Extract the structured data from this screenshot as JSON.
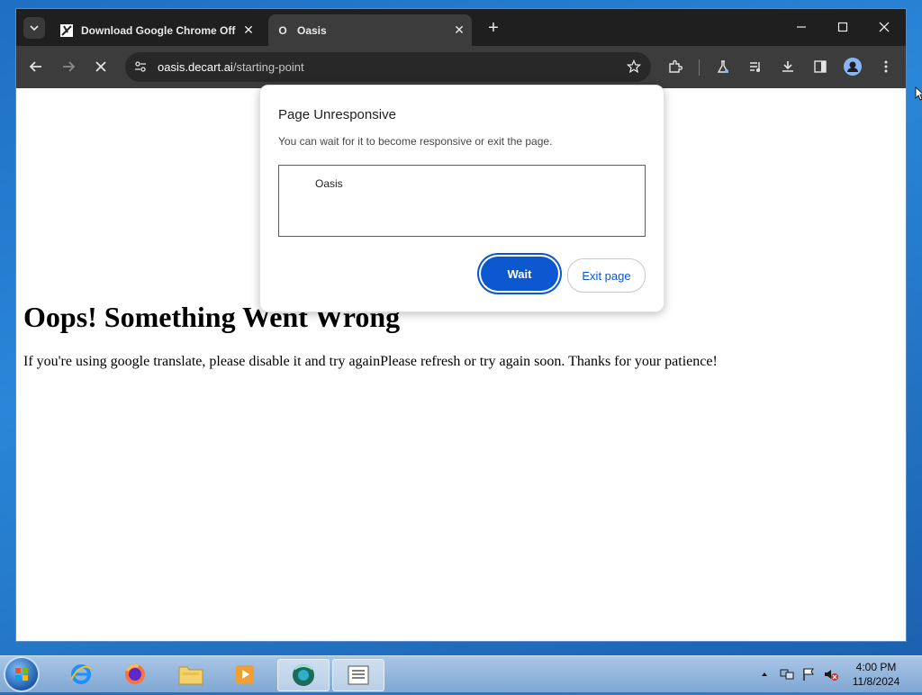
{
  "browser": {
    "tab_list_icon": "chevron-down-icon",
    "tabs": [
      {
        "title": "Download Google Chrome Off",
        "favicon": "chrome-logo-icon",
        "active": false
      },
      {
        "title": "Oasis",
        "favicon": "oasis-favicon",
        "favicon_glyph": "O",
        "active": true
      }
    ],
    "new_tab_glyph": "+",
    "close_glyph": "✕",
    "url_host": "oasis.decart.ai",
    "url_path": "/starting-point"
  },
  "page": {
    "heading": "Oops! Something Went Wrong",
    "message": "If you're using google translate, please disable it and try againPlease refresh or try again soon. Thanks for your patience!"
  },
  "dialog": {
    "title": "Page Unresponsive",
    "message": "You can wait for it to become responsive or exit the page.",
    "list_items": [
      "Oasis"
    ],
    "wait_label": "Wait",
    "exit_label": "Exit page"
  },
  "taskbar": {
    "time": "4:00 PM",
    "date": "11/8/2024"
  },
  "colors": {
    "accent": "#0b57d0",
    "chrome_dark": "#1f1f1f",
    "toolbar": "#3c3c3c"
  }
}
